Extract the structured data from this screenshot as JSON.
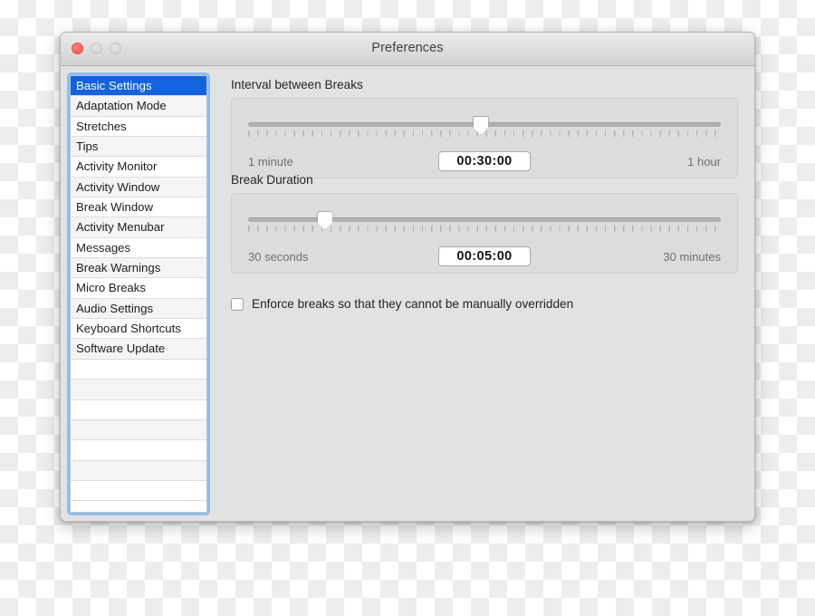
{
  "window": {
    "title": "Preferences",
    "traffic_lights": [
      {
        "name": "close-button",
        "color": "#fb665c"
      },
      {
        "name": "minimize-button",
        "color": "#d9d9d9"
      },
      {
        "name": "zoom-button",
        "color": "#d9d9d9"
      }
    ]
  },
  "sidebar": {
    "selected_index": 0,
    "items": [
      {
        "label": "Basic Settings"
      },
      {
        "label": "Adaptation Mode"
      },
      {
        "label": "Stretches"
      },
      {
        "label": "Tips"
      },
      {
        "label": "Activity Monitor"
      },
      {
        "label": "Activity Window"
      },
      {
        "label": "Break Window"
      },
      {
        "label": "Activity Menubar"
      },
      {
        "label": "Messages"
      },
      {
        "label": "Break Warnings"
      },
      {
        "label": "Micro Breaks"
      },
      {
        "label": "Audio Settings"
      },
      {
        "label": "Keyboard Shortcuts"
      },
      {
        "label": "Software Update"
      }
    ],
    "empty_row_count": 7,
    "selection_color": "#1263dd",
    "focus_ring_color": "#8cbdf0"
  },
  "main": {
    "interval_section": {
      "title": "Interval between Breaks",
      "value": "00:30:00",
      "min_label": "1 minute",
      "max_label": "1 hour",
      "thumb_percent": 49
    },
    "duration_section": {
      "title": "Break Duration",
      "value": "00:05:00",
      "min_label": "30 seconds",
      "max_label": "30 minutes",
      "thumb_percent": 16
    },
    "enforce_checkbox": {
      "label": "Enforce breaks so that they cannot be manually overridden",
      "checked": false
    }
  }
}
